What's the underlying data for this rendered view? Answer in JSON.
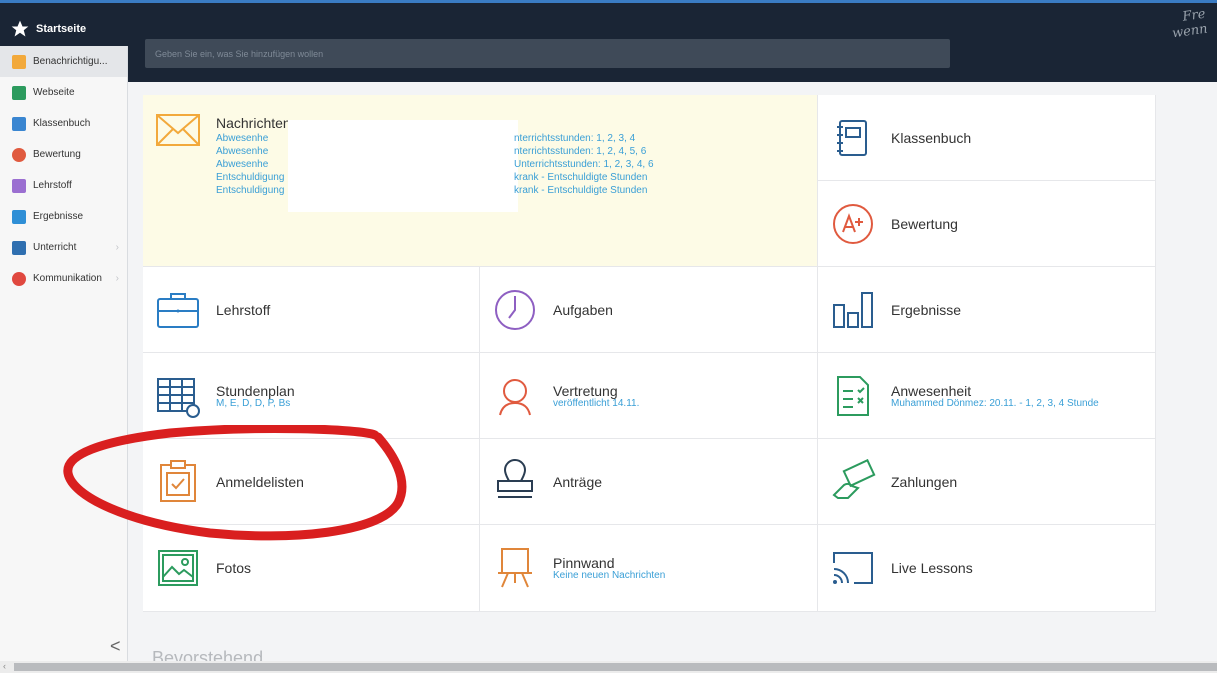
{
  "header": {
    "brand_label": "Startseite",
    "search_placeholder": "Geben Sie ein, was Sie hinzufügen wollen",
    "corner_text_1": "Fre",
    "corner_text_2": "wenn"
  },
  "sidebar": {
    "items": [
      {
        "label": "Benachrichtigu...",
        "icon": "envelope-icon",
        "color": "#f2a93b"
      },
      {
        "label": "Webseite",
        "icon": "home-icon",
        "color": "#2c9b5e"
      },
      {
        "label": "Klassenbuch",
        "icon": "book-icon",
        "color": "#3a86d1"
      },
      {
        "label": "Bewertung",
        "icon": "grade-icon",
        "color": "#e05a3f"
      },
      {
        "label": "Lehrstoff",
        "icon": "teacher-icon",
        "color": "#9b6fd1"
      },
      {
        "label": "Ergebnisse",
        "icon": "bar-chart-icon",
        "color": "#2f8fd6"
      },
      {
        "label": "Unterricht",
        "icon": "open-book-icon",
        "color": "#2f6fb0"
      },
      {
        "label": "Kommunikation",
        "icon": "chat-icon",
        "color": "#e0483f"
      }
    ],
    "collapse_label": "<"
  },
  "tiles": {
    "nachrichten": {
      "title": "Nachrichten",
      "left_lines": [
        "Abwesenhe",
        "Abwesenhe",
        "Abwesenhe",
        "Entschuldigung",
        "Entschuldigung"
      ],
      "right_lines": [
        "nterrichtsstunden: 1, 2, 3, 4",
        "nterrichtsstunden: 1, 2, 4, 5, 6",
        "Unterrichtsstunden: 1, 2, 3, 4, 6",
        "krank - Entschuldigte Stunden",
        "krank - Entschuldigte Stunden"
      ]
    },
    "klassenbuch": {
      "title": "Klassenbuch"
    },
    "bewertung": {
      "title": "Bewertung"
    },
    "lehrstoff": {
      "title": "Lehrstoff"
    },
    "aufgaben": {
      "title": "Aufgaben"
    },
    "ergebnisse": {
      "title": "Ergebnisse"
    },
    "stundenplan": {
      "title": "Stundenplan",
      "sub": "M, E, D, D, P, Bs"
    },
    "vertretung": {
      "title": "Vertretung",
      "sub": "veröffentlicht 14.11."
    },
    "anwesenheit": {
      "title": "Anwesenheit",
      "sub": "Muhammed Dönmez: 20.11. - 1, 2, 3, 4 Stunde"
    },
    "anmeldelisten": {
      "title": "Anmeldelisten"
    },
    "antraege": {
      "title": "Anträge"
    },
    "zahlungen": {
      "title": "Zahlungen"
    },
    "fotos": {
      "title": "Fotos"
    },
    "pinnwand": {
      "title": "Pinnwand",
      "sub": "Keine neuen Nachrichten"
    },
    "live_lessons": {
      "title": "Live Lessons"
    }
  },
  "footer": {
    "upcoming_label": "Bevorstehend"
  },
  "colors": {
    "accent_link": "#3a9fd6",
    "topbar": "#1a2535",
    "annotation_red": "#d91f1f"
  }
}
